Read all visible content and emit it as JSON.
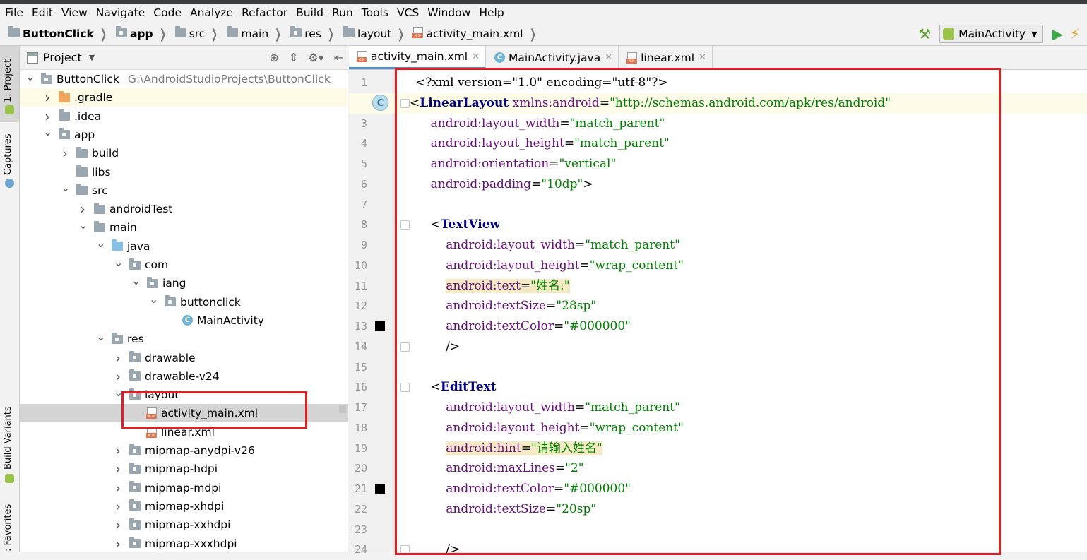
{
  "menu": [
    "File",
    "Edit",
    "View",
    "Navigate",
    "Code",
    "Analyze",
    "Refactor",
    "Build",
    "Run",
    "Tools",
    "VCS",
    "Window",
    "Help"
  ],
  "breadcrumb": [
    {
      "label": "ButtonClick",
      "bold": true,
      "icon": "project-folder-icon"
    },
    {
      "label": "app",
      "bold": true,
      "icon": "module-folder-icon"
    },
    {
      "label": "src",
      "icon": "folder-icon"
    },
    {
      "label": "main",
      "icon": "folder-icon"
    },
    {
      "label": "res",
      "icon": "res-folder-icon"
    },
    {
      "label": "layout",
      "icon": "folder-icon"
    },
    {
      "label": "activity_main.xml",
      "icon": "xml-file-icon"
    }
  ],
  "run_config": "MainActivity",
  "toolwindows": {
    "project": "1: Project",
    "captures": "Captures",
    "build_variants": "Build Variants",
    "favorites": ": Favorites"
  },
  "project_panel": {
    "title": "Project",
    "tree": [
      {
        "label": "ButtonClick",
        "path": "G:\\AndroidStudioProjects\\ButtonClick",
        "indent": 0,
        "arrow": "down",
        "icon": "project"
      },
      {
        "label": ".gradle",
        "indent": 1,
        "arrow": "right",
        "icon": "orange"
      },
      {
        "label": ".idea",
        "indent": 1,
        "arrow": "right",
        "icon": "gray"
      },
      {
        "label": "app",
        "indent": 1,
        "arrow": "down",
        "icon": "module"
      },
      {
        "label": "build",
        "indent": 2,
        "arrow": "right",
        "icon": "gray"
      },
      {
        "label": "libs",
        "indent": 2,
        "arrow": "",
        "icon": "gray"
      },
      {
        "label": "src",
        "indent": 2,
        "arrow": "down",
        "icon": "gray"
      },
      {
        "label": "androidTest",
        "indent": 3,
        "arrow": "right",
        "icon": "gray"
      },
      {
        "label": "main",
        "indent": 3,
        "arrow": "down",
        "icon": "gray"
      },
      {
        "label": "java",
        "indent": 4,
        "arrow": "down",
        "icon": "blue"
      },
      {
        "label": "com",
        "indent": 5,
        "arrow": "down",
        "icon": "pkg"
      },
      {
        "label": "iang",
        "indent": 6,
        "arrow": "down",
        "icon": "pkg"
      },
      {
        "label": "buttonclick",
        "indent": 7,
        "arrow": "down",
        "icon": "pkg"
      },
      {
        "label": "MainActivity",
        "indent": 8,
        "arrow": "",
        "icon": "class"
      },
      {
        "label": "res",
        "indent": 4,
        "arrow": "down",
        "icon": "res"
      },
      {
        "label": "drawable",
        "indent": 5,
        "arrow": "right",
        "icon": "pkg"
      },
      {
        "label": "drawable-v24",
        "indent": 5,
        "arrow": "right",
        "icon": "pkg"
      },
      {
        "label": "layout",
        "indent": 5,
        "arrow": "down",
        "icon": "pkg"
      },
      {
        "label": "activity_main.xml",
        "indent": 6,
        "arrow": "",
        "icon": "xml",
        "selected": true
      },
      {
        "label": "linear.xml",
        "indent": 6,
        "arrow": "",
        "icon": "xml"
      },
      {
        "label": "mipmap-anydpi-v26",
        "indent": 5,
        "arrow": "right",
        "icon": "pkg"
      },
      {
        "label": "mipmap-hdpi",
        "indent": 5,
        "arrow": "right",
        "icon": "pkg"
      },
      {
        "label": "mipmap-mdpi",
        "indent": 5,
        "arrow": "right",
        "icon": "pkg"
      },
      {
        "label": "mipmap-xhdpi",
        "indent": 5,
        "arrow": "right",
        "icon": "pkg"
      },
      {
        "label": "mipmap-xxhdpi",
        "indent": 5,
        "arrow": "right",
        "icon": "pkg"
      },
      {
        "label": "mipmap-xxxhdpi",
        "indent": 5,
        "arrow": "right",
        "icon": "pkg"
      }
    ]
  },
  "editor_tabs": [
    {
      "label": "activity_main.xml",
      "icon": "xml",
      "active": true
    },
    {
      "label": "MainActivity.java",
      "icon": "class",
      "active": false
    },
    {
      "label": "linear.xml",
      "icon": "xml",
      "active": false
    }
  ],
  "code_lines": [
    {
      "n": "1",
      "parts": [
        [
          "pun",
          "<?xml version=\"1.0\" encoding=\"utf-8\"?>"
        ]
      ]
    },
    {
      "n": "2",
      "current": true,
      "parts": [
        [
          "pun",
          "<"
        ],
        [
          "tagname",
          "LinearLayout"
        ],
        [
          "pun",
          " "
        ],
        [
          "attr",
          "xmlns:android"
        ],
        [
          "pun",
          "="
        ],
        [
          "val",
          "\"http://schemas.android.com/apk/res/android\""
        ]
      ]
    },
    {
      "n": "3",
      "parts": [
        [
          "pun",
          "    "
        ],
        [
          "attr",
          "android:layout_width"
        ],
        [
          "pun",
          "="
        ],
        [
          "val",
          "\"match_parent\""
        ]
      ]
    },
    {
      "n": "4",
      "parts": [
        [
          "pun",
          "    "
        ],
        [
          "attr",
          "android:layout_height"
        ],
        [
          "pun",
          "="
        ],
        [
          "val",
          "\"match_parent\""
        ]
      ]
    },
    {
      "n": "5",
      "parts": [
        [
          "pun",
          "    "
        ],
        [
          "attr",
          "android:orientation"
        ],
        [
          "pun",
          "="
        ],
        [
          "val",
          "\"vertical\""
        ]
      ]
    },
    {
      "n": "6",
      "parts": [
        [
          "pun",
          "    "
        ],
        [
          "attr",
          "android:padding"
        ],
        [
          "pun",
          "="
        ],
        [
          "val",
          "\"10dp\""
        ],
        [
          "pun",
          ">"
        ]
      ]
    },
    {
      "n": "7",
      "parts": []
    },
    {
      "n": "8",
      "parts": [
        [
          "pun",
          "    <"
        ],
        [
          "tagname",
          "TextView"
        ]
      ]
    },
    {
      "n": "9",
      "parts": [
        [
          "pun",
          "        "
        ],
        [
          "attr",
          "android:layout_width"
        ],
        [
          "pun",
          "="
        ],
        [
          "val",
          "\"match_parent\""
        ]
      ]
    },
    {
      "n": "10",
      "parts": [
        [
          "pun",
          "        "
        ],
        [
          "attr",
          "android:layout_height"
        ],
        [
          "pun",
          "="
        ],
        [
          "val",
          "\"wrap_content\""
        ]
      ]
    },
    {
      "n": "11",
      "parts": [
        [
          "pun",
          "        "
        ],
        [
          "attr hlattr",
          "android:text"
        ],
        [
          "pun hlattr",
          "="
        ],
        [
          "val hlattr",
          "\"姓名:\""
        ]
      ]
    },
    {
      "n": "12",
      "parts": [
        [
          "pun",
          "        "
        ],
        [
          "attr",
          "android:textSize"
        ],
        [
          "pun",
          "="
        ],
        [
          "val",
          "\"28sp\""
        ]
      ]
    },
    {
      "n": "13",
      "parts": [
        [
          "pun",
          "        "
        ],
        [
          "attr",
          "android:textColor"
        ],
        [
          "pun",
          "="
        ],
        [
          "val",
          "\"#000000\""
        ]
      ]
    },
    {
      "n": "14",
      "parts": [
        [
          "pun",
          "        />"
        ]
      ]
    },
    {
      "n": "15",
      "parts": []
    },
    {
      "n": "16",
      "parts": [
        [
          "pun",
          "    <"
        ],
        [
          "tagname",
          "EditText"
        ]
      ]
    },
    {
      "n": "17",
      "parts": [
        [
          "pun",
          "        "
        ],
        [
          "attr",
          "android:layout_width"
        ],
        [
          "pun",
          "="
        ],
        [
          "val",
          "\"match_parent\""
        ]
      ]
    },
    {
      "n": "18",
      "parts": [
        [
          "pun",
          "        "
        ],
        [
          "attr",
          "android:layout_height"
        ],
        [
          "pun",
          "="
        ],
        [
          "val",
          "\"wrap_content\""
        ]
      ]
    },
    {
      "n": "19",
      "parts": [
        [
          "pun",
          "        "
        ],
        [
          "attr hlattr",
          "android:hint"
        ],
        [
          "pun hlattr",
          "="
        ],
        [
          "val hlattr",
          "\"请输入姓名\""
        ]
      ]
    },
    {
      "n": "20",
      "parts": [
        [
          "pun",
          "        "
        ],
        [
          "attr",
          "android:maxLines"
        ],
        [
          "pun",
          "="
        ],
        [
          "val",
          "\"2\""
        ]
      ]
    },
    {
      "n": "21",
      "parts": [
        [
          "pun",
          "        "
        ],
        [
          "attr",
          "android:textColor"
        ],
        [
          "pun",
          "="
        ],
        [
          "val",
          "\"#000000\""
        ]
      ]
    },
    {
      "n": "22",
      "parts": [
        [
          "pun",
          "        "
        ],
        [
          "attr",
          "android:textSize"
        ],
        [
          "pun",
          "="
        ],
        [
          "val",
          "\"20sp\""
        ]
      ]
    },
    {
      "n": "23",
      "parts": []
    },
    {
      "n": "24",
      "parts": [
        [
          "pun",
          "        />"
        ]
      ]
    }
  ],
  "colors": {
    "highlight_box": "#e02020",
    "tag": "#000080",
    "attr": "#660e7a",
    "value": "#008000"
  }
}
